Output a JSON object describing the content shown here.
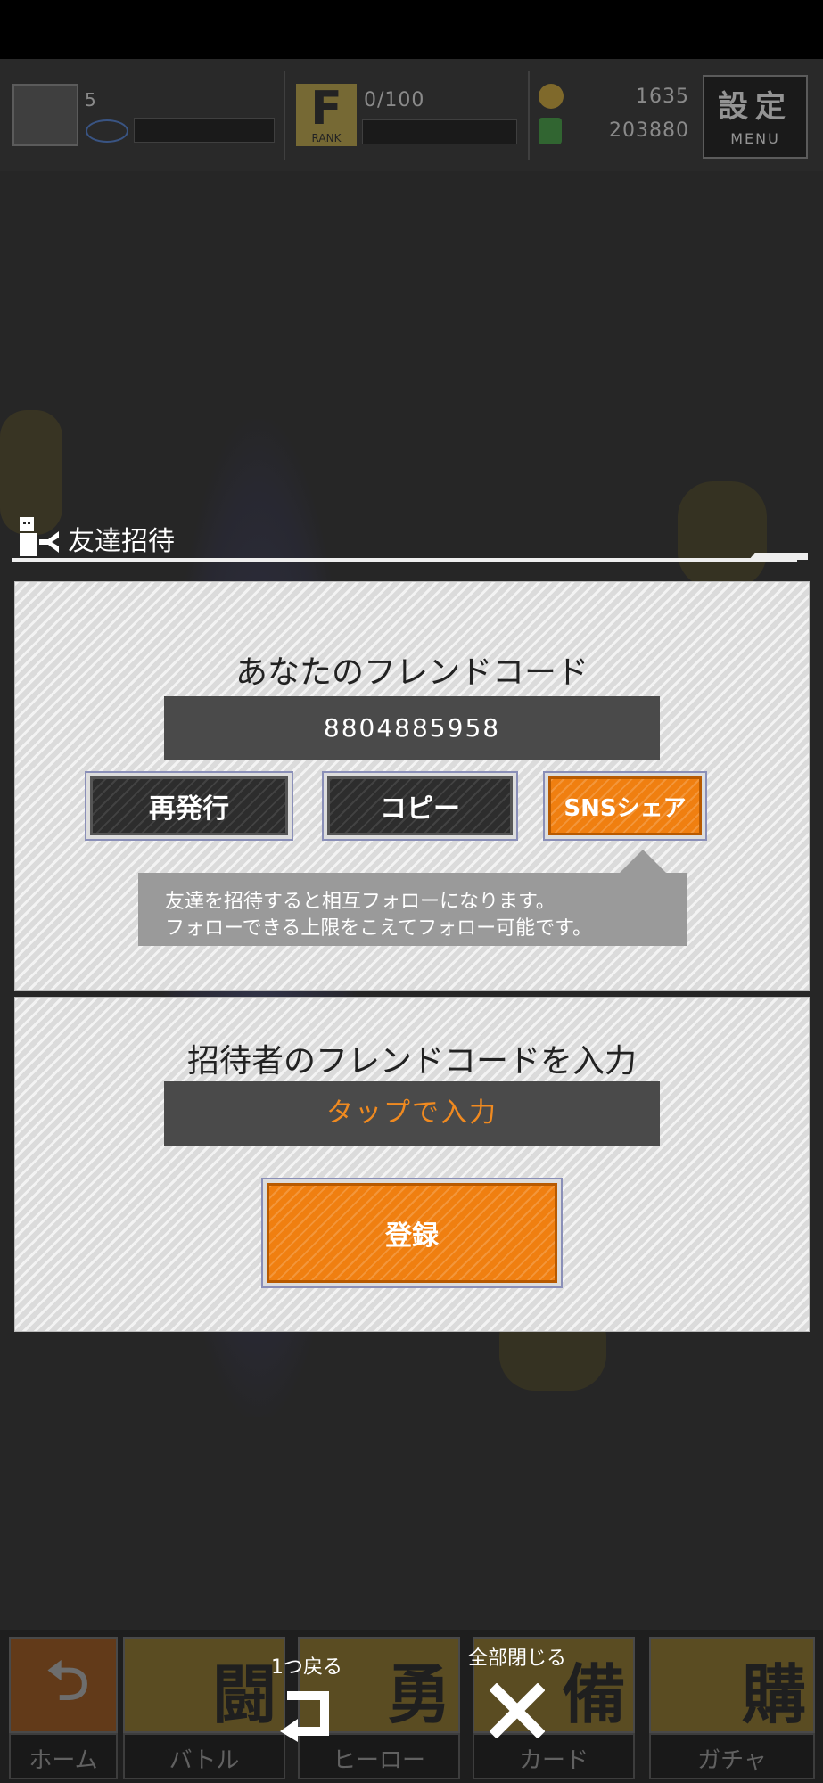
{
  "hud": {
    "player_level": "5",
    "rank_letter": "F",
    "rank_label": "RANK",
    "rank_progress": "0/100",
    "coins": "1635",
    "gems": "203880",
    "menu_title": "設定",
    "menu_sub": "MENU"
  },
  "section": {
    "title": "友達招待"
  },
  "friend_code_panel": {
    "heading": "あなたのフレンドコード",
    "code": "8804885958",
    "buttons": {
      "reissue": "再発行",
      "copy": "コピー",
      "sns_share": "SNSシェア"
    },
    "tooltip_line1": "友達を招待すると相互フォローになります。",
    "tooltip_line2": "フォローできる上限をこえてフォロー可能です。"
  },
  "inviter_panel": {
    "heading": "招待者のフレンドコードを入力",
    "input_placeholder": "タップで入力",
    "register_button": "登録"
  },
  "bottom_nav": {
    "items": [
      {
        "label": "ホーム",
        "kanji": ""
      },
      {
        "label": "バトル",
        "kanji": "闘"
      },
      {
        "label": "ヒーロー",
        "kanji": "勇"
      },
      {
        "label": "カード",
        "kanji": "備"
      },
      {
        "label": "ガチャ",
        "kanji": "購"
      }
    ],
    "back_one": "1つ戻る",
    "close_all": "全部閉じる"
  },
  "colors": {
    "accent_orange": "#f07f10",
    "tap_text": "#f08a20",
    "panel_bg": "#e4e4e4",
    "dark_button": "#2d2d2d"
  }
}
